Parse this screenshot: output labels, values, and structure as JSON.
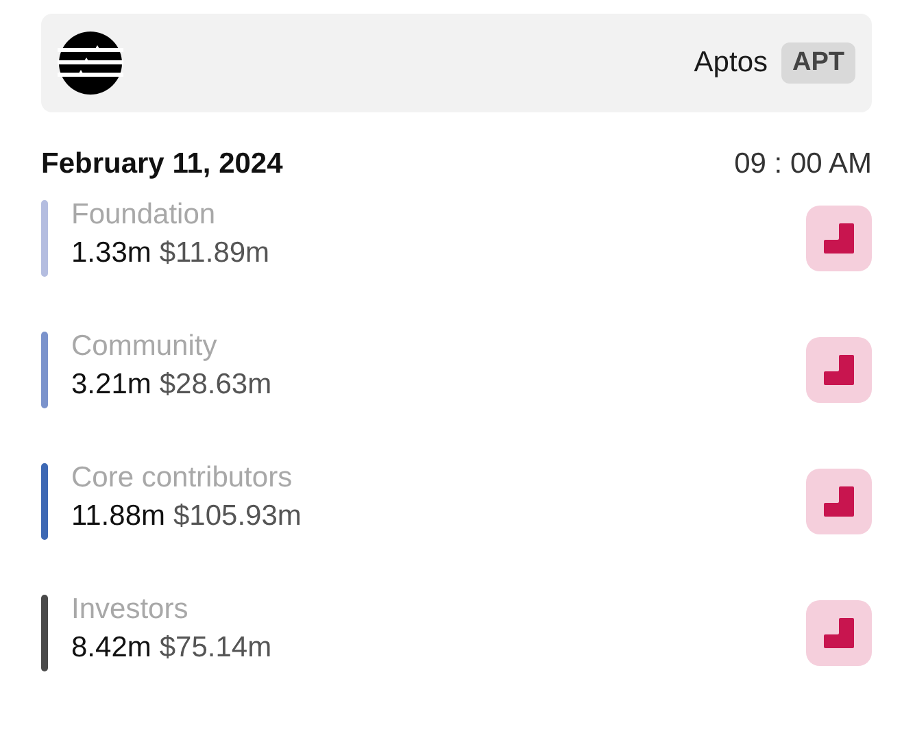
{
  "header": {
    "name": "Aptos",
    "ticker": "APT"
  },
  "date": "February 11, 2024",
  "time": "09 : 00 AM",
  "allocations": [
    {
      "label": "Foundation",
      "amount": "1.33m",
      "value": "$11.89m",
      "color": "#b4bde0"
    },
    {
      "label": "Community",
      "amount": "3.21m",
      "value": "$28.63m",
      "color": "#7b93cc"
    },
    {
      "label": "Core contributors",
      "amount": "11.88m",
      "value": "$105.93m",
      "color": "#3d68b4"
    },
    {
      "label": "Investors",
      "amount": "8.42m",
      "value": "$75.14m",
      "color": "#4a4a4a"
    }
  ]
}
